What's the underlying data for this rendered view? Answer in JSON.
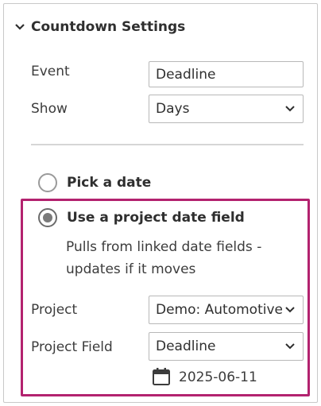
{
  "section": {
    "title": "Countdown Settings",
    "expanded": true,
    "icon": "chevron-down-icon"
  },
  "event": {
    "label": "Event",
    "value": "Deadline"
  },
  "show": {
    "label": "Show",
    "value": "Days"
  },
  "options": {
    "pick_date": {
      "label": "Pick a date",
      "selected": false
    },
    "project_field": {
      "label": "Use a project date field",
      "selected": true,
      "description": "Pulls from linked date fields - updates if it moves"
    }
  },
  "project": {
    "label": "Project",
    "value": "Demo: Automotive"
  },
  "project_field": {
    "label": "Project Field",
    "value": "Deadline"
  },
  "resolved_date": {
    "icon": "calendar-icon",
    "value": "2025-06-11"
  },
  "colors": {
    "highlight": "#b3226f",
    "border": "#c8c8c8",
    "text": "#3c3c3c"
  }
}
